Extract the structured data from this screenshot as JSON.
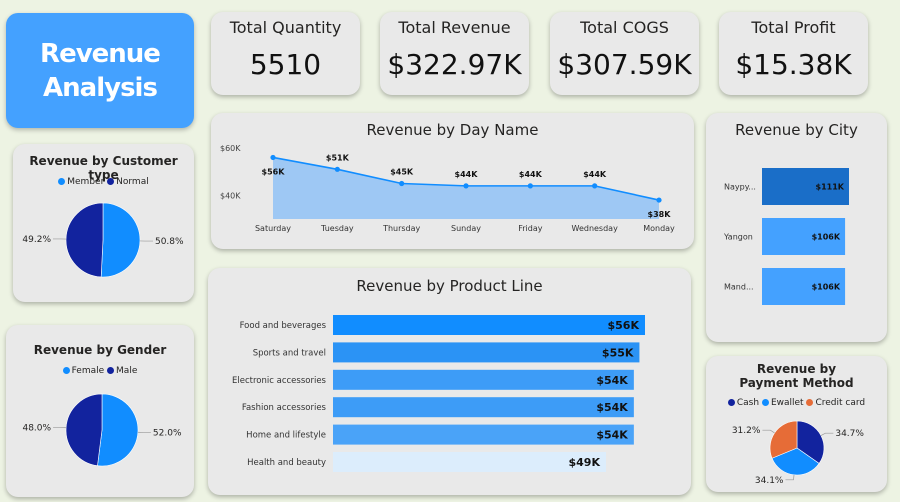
{
  "title": {
    "line1": "Revenue",
    "line2": "Analysis"
  },
  "kpis": [
    {
      "label": "Total Quantity",
      "value": "5510"
    },
    {
      "label": "Total Revenue",
      "value": "$322.97K"
    },
    {
      "label": "Total COGS",
      "value": "$307.59K"
    },
    {
      "label": "Total Profit",
      "value": "$15.38K"
    }
  ],
  "colors": {
    "accent": "#44a1ff",
    "dark_blue": "#12239e",
    "mid_blue": "#118dff",
    "deep_blue": "#1a6ec8",
    "orange": "#e66c37",
    "area_fill": "#9ec8f4"
  },
  "chart_data": [
    {
      "id": "customer_type",
      "type": "pie",
      "title": "Revenue by Customer type",
      "legend": [
        "Member",
        "Normal"
      ],
      "series": [
        {
          "name": "Member",
          "value": 50.8,
          "label": "50.8%",
          "color": "#118dff"
        },
        {
          "name": "Normal",
          "value": 49.2,
          "label": "49.2%",
          "color": "#12239e"
        }
      ]
    },
    {
      "id": "gender",
      "type": "pie",
      "title": "Revenue by Gender",
      "legend": [
        "Female",
        "Male"
      ],
      "series": [
        {
          "name": "Female",
          "value": 52.0,
          "label": "52.0%",
          "color": "#118dff"
        },
        {
          "name": "Male",
          "value": 48.0,
          "label": "48.0%",
          "color": "#12239e"
        }
      ]
    },
    {
      "id": "day_name",
      "type": "area",
      "title": "Revenue by Day Name",
      "categories": [
        "Saturday",
        "Tuesday",
        "Thursday",
        "Sunday",
        "Friday",
        "Wednesday",
        "Monday"
      ],
      "values": [
        56,
        51,
        45,
        44,
        44,
        44,
        38
      ],
      "labels": [
        "$56K",
        "$51K",
        "$45K",
        "$44K",
        "$44K",
        "$44K",
        "$38K"
      ],
      "yticks": [
        "$60K",
        "$40K"
      ],
      "ytick_values": [
        60,
        40
      ],
      "ylim": [
        30,
        60
      ]
    },
    {
      "id": "city",
      "type": "bar",
      "title": "Revenue by City",
      "categories": [
        "Naypy...",
        "Yangon",
        "Mand..."
      ],
      "values": [
        111,
        106,
        106
      ],
      "labels": [
        "$111K",
        "$106K",
        "$106K"
      ],
      "colors": [
        "#1a6ec8",
        "#44a1ff",
        "#44a1ff"
      ]
    },
    {
      "id": "product_line",
      "type": "bar",
      "title": "Revenue by Product Line",
      "categories": [
        "Food and beverages",
        "Sports and travel",
        "Electronic accessories",
        "Fashion accessories",
        "Home and lifestyle",
        "Health and beauty"
      ],
      "values": [
        56,
        55,
        54,
        54,
        54,
        49
      ],
      "labels": [
        "$56K",
        "$55K",
        "$54K",
        "$54K",
        "$54K",
        "$49K"
      ],
      "colors": [
        "#118dff",
        "#2b93f5",
        "#3d9cf7",
        "#3d9cf7",
        "#4aa3f8",
        "#dcedfc"
      ]
    },
    {
      "id": "payment",
      "type": "pie",
      "title": "Revenue by Payment Method",
      "legend": [
        "Cash",
        "Ewallet",
        "Credit card"
      ],
      "series": [
        {
          "name": "Cash",
          "value": 34.7,
          "label": "34.7%",
          "color": "#12239e"
        },
        {
          "name": "Ewallet",
          "value": 34.1,
          "label": "34.1%",
          "color": "#118dff"
        },
        {
          "name": "Credit card",
          "value": 31.2,
          "label": "31.2%",
          "color": "#e66c37"
        }
      ]
    }
  ]
}
